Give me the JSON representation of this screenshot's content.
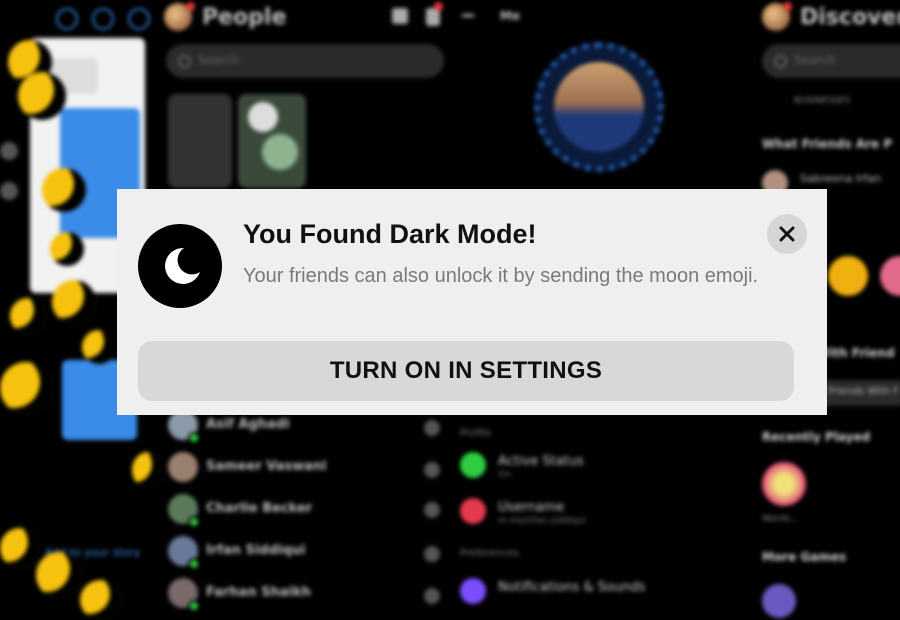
{
  "background": {
    "people": {
      "title": "People",
      "search_placeholder": "Search",
      "contacts": [
        {
          "name": "Asif Aghadi",
          "color": "#8a9aa8"
        },
        {
          "name": "Sameer Vaswani",
          "color": "#9a8070"
        },
        {
          "name": "Charlie Becker",
          "color": "#5a7a5a"
        },
        {
          "name": "Irfan Siddiqui",
          "color": "#6a7a9a"
        },
        {
          "name": "Farhan Shaikh",
          "color": "#7a6a6a"
        }
      ]
    },
    "me": {
      "title": "Me",
      "section_profile": "Profile",
      "section_preferences": "Preferences",
      "rows": [
        {
          "label": "Active Status",
          "sub": "On",
          "color": "#2ecc40"
        },
        {
          "label": "Username",
          "sub": "m.me/irfan.siddiqui",
          "color": "#e53950"
        },
        {
          "label": "Notifications & Sounds",
          "sub": "",
          "color": "#7c4dff"
        }
      ]
    },
    "discover": {
      "title": "Discover",
      "search_placeholder": "Search",
      "businesses_label": "BUSINESSES",
      "friends_are_playing": "What Friends Are P",
      "friend_name": "Sabreena Irfan",
      "recently_played": "Recently Played",
      "game_caption": "Words...",
      "more_games": "More Games",
      "with_friends": "With Friend",
      "friends_with": "Friends With F"
    },
    "story": {
      "add_label": "Add to your story"
    }
  },
  "modal": {
    "title": "You Found Dark Mode!",
    "body": "Your friends can also unlock it by sending the moon emoji.",
    "button_label": "TURN ON IN SETTINGS",
    "close_label": "×"
  },
  "colors": {
    "modal_bg": "#efefef",
    "button_bg": "#d8d8d8",
    "accent_blue": "#2e7bd6",
    "online_green": "#2ecc40"
  }
}
